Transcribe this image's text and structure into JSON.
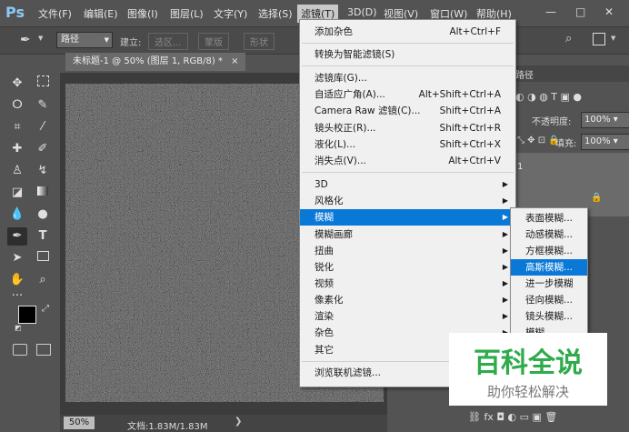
{
  "app": {
    "logo": "Ps"
  },
  "menubar": {
    "items": [
      "文件(F)",
      "编辑(E)",
      "图像(I)",
      "图层(L)",
      "文字(Y)",
      "选择(S)",
      "滤镜(T)",
      "3D(D)",
      "视图(V)",
      "窗口(W)",
      "帮助(H)"
    ],
    "active": "滤镜(T)",
    "window_buttons": [
      "—",
      "□",
      "✕"
    ]
  },
  "options": {
    "mode": "路径",
    "build_label": "建立:",
    "selection_btn": "选区...",
    "mask_btn": "蒙版",
    "shape_btn": "形状"
  },
  "document": {
    "tab_title": "未标题-1 @ 50% (图层 1, RGB/8) *",
    "zoom": "50%",
    "info": "文档:1.83M/1.83M"
  },
  "right_panel": {
    "tab": "路径",
    "opacity_label": "不透明度:",
    "opacity_value": "100%",
    "fill_label": "填充:",
    "fill_value": "100%",
    "layer_num": "1"
  },
  "filter_menu": {
    "items": [
      {
        "label": "添加杂色",
        "shortcut": "Alt+Ctrl+F"
      },
      {
        "label": "转换为智能滤镜(S)",
        "shortcut": ""
      },
      {
        "label": "滤镜库(G)...",
        "shortcut": ""
      },
      {
        "label": "自适应广角(A)...",
        "shortcut": "Alt+Shift+Ctrl+A"
      },
      {
        "label": "Camera Raw 滤镜(C)...",
        "shortcut": "Shift+Ctrl+A"
      },
      {
        "label": "镜头校正(R)...",
        "shortcut": "Shift+Ctrl+R"
      },
      {
        "label": "液化(L)...",
        "shortcut": "Shift+Ctrl+X"
      },
      {
        "label": "消失点(V)...",
        "shortcut": "Alt+Ctrl+V"
      },
      {
        "label": "3D",
        "shortcut": ""
      },
      {
        "label": "风格化",
        "shortcut": ""
      },
      {
        "label": "模糊",
        "shortcut": ""
      },
      {
        "label": "模糊画廊",
        "shortcut": ""
      },
      {
        "label": "扭曲",
        "shortcut": ""
      },
      {
        "label": "锐化",
        "shortcut": ""
      },
      {
        "label": "视频",
        "shortcut": ""
      },
      {
        "label": "像素化",
        "shortcut": ""
      },
      {
        "label": "渲染",
        "shortcut": ""
      },
      {
        "label": "杂色",
        "shortcut": ""
      },
      {
        "label": "其它",
        "shortcut": ""
      },
      {
        "label": "浏览联机滤镜...",
        "shortcut": ""
      }
    ],
    "highlighted": "模糊"
  },
  "blur_submenu": {
    "items": [
      "表面模糊...",
      "动感模糊...",
      "方框模糊...",
      "高斯模糊...",
      "进一步模糊",
      "径向模糊...",
      "镜头模糊...",
      "模糊"
    ],
    "highlighted": "高斯模糊..."
  },
  "watermark": {
    "title": "百科全说",
    "subtitle": "助你轻松解决"
  },
  "colors": {
    "highlight": "#0a78d7",
    "watermark_green": "#2eab4b"
  }
}
